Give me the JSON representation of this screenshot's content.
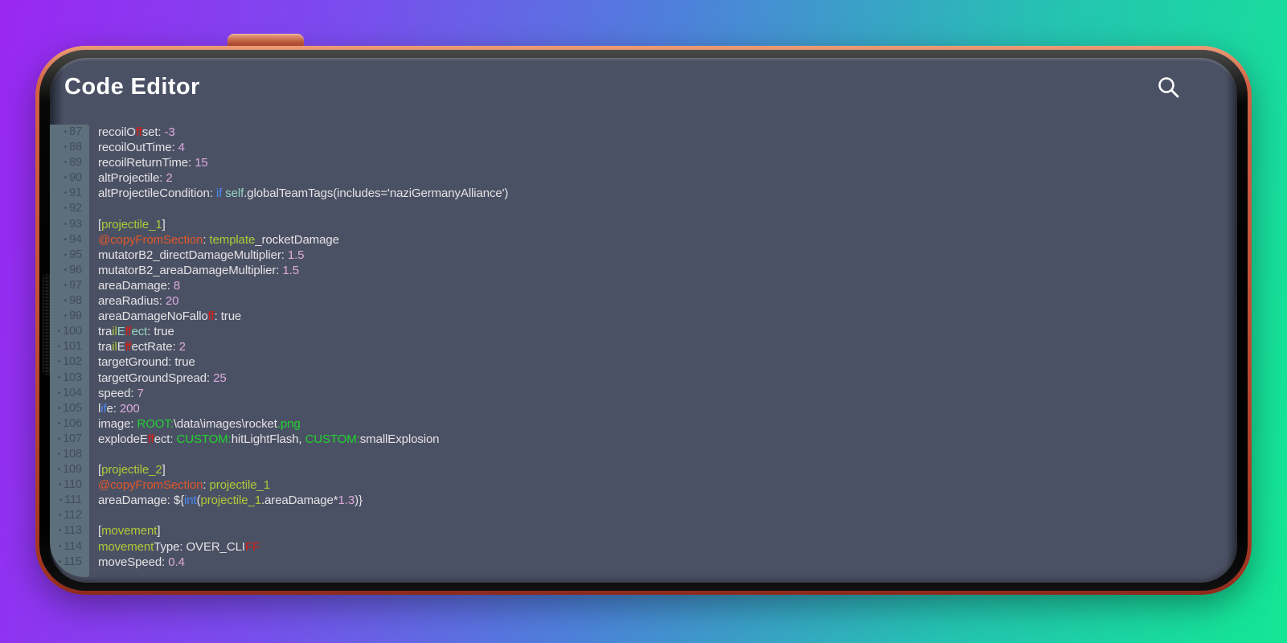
{
  "app": {
    "title": "Code Editor",
    "icons": {
      "search": "magnifying-glass"
    }
  },
  "colors": {
    "background_gradient": [
      "#9a27f2",
      "#13e794"
    ],
    "phone_rim": "#c14e36",
    "screen_bg": "#4b5164",
    "gutter_bg": "#5d6f7a",
    "line_number": "#434c60",
    "title_text": "#ffffff",
    "syntax": {
      "fg": "#e4e2e5",
      "num": "#dcaade",
      "kw": "#4a8bf5",
      "red": "#dd1d15",
      "sect": "#aeca38",
      "at": "#e2562a",
      "path": "#21d32f",
      "mint": "#98d6c2"
    }
  },
  "editor": {
    "bullet_char": "•",
    "first_line_number": 87,
    "last_line_number": 115,
    "lines": [
      {
        "n": 87,
        "segments": [
          {
            "t": "recoilO",
            "c": "fg"
          },
          {
            "t": "ff",
            "c": "red"
          },
          {
            "t": "set: ",
            "c": "fg"
          },
          {
            "t": "-3",
            "c": "num"
          }
        ]
      },
      {
        "n": 88,
        "segments": [
          {
            "t": "recoilOutTime: ",
            "c": "fg"
          },
          {
            "t": "4",
            "c": "num"
          }
        ]
      },
      {
        "n": 89,
        "segments": [
          {
            "t": "recoilReturnTime: ",
            "c": "fg"
          },
          {
            "t": "15",
            "c": "num"
          }
        ]
      },
      {
        "n": 90,
        "segments": [
          {
            "t": "altProjectile: ",
            "c": "fg"
          },
          {
            "t": "2",
            "c": "num"
          }
        ]
      },
      {
        "n": 91,
        "segments": [
          {
            "t": "altProjectileCondition: ",
            "c": "fg"
          },
          {
            "t": "if",
            "c": "kw"
          },
          {
            "t": " ",
            "c": "fg"
          },
          {
            "t": "self",
            "c": "mint"
          },
          {
            "t": ".globalTeamTags(includes='naziGermanyAlliance')",
            "c": "fg"
          }
        ]
      },
      {
        "n": 92,
        "segments": []
      },
      {
        "n": 93,
        "segments": [
          {
            "t": "[",
            "c": "fg"
          },
          {
            "t": "projectile_1",
            "c": "sect"
          },
          {
            "t": "]",
            "c": "fg"
          }
        ]
      },
      {
        "n": 94,
        "segments": [
          {
            "t": "@copyFromSection",
            "c": "at"
          },
          {
            "t": ": ",
            "c": "fg"
          },
          {
            "t": "template",
            "c": "sect"
          },
          {
            "t": "_rocketDamage",
            "c": "fg"
          }
        ]
      },
      {
        "n": 95,
        "segments": [
          {
            "t": "mutatorB2_directDamageMultiplier: ",
            "c": "fg"
          },
          {
            "t": "1.5",
            "c": "num"
          }
        ]
      },
      {
        "n": 96,
        "segments": [
          {
            "t": "mutatorB2_areaDamageMultiplier: ",
            "c": "fg"
          },
          {
            "t": "1.5",
            "c": "num"
          }
        ]
      },
      {
        "n": 97,
        "segments": [
          {
            "t": "areaDamage: ",
            "c": "fg"
          },
          {
            "t": "8",
            "c": "num"
          }
        ]
      },
      {
        "n": 98,
        "segments": [
          {
            "t": "areaRadius: ",
            "c": "fg"
          },
          {
            "t": "20",
            "c": "num"
          }
        ]
      },
      {
        "n": 99,
        "segments": [
          {
            "t": "areaDamageNoFallo",
            "c": "fg"
          },
          {
            "t": "ff",
            "c": "red"
          },
          {
            "t": ": true",
            "c": "fg"
          }
        ]
      },
      {
        "n": 100,
        "segments": [
          {
            "t": "tra",
            "c": "fg"
          },
          {
            "t": "il",
            "c": "sect"
          },
          {
            "t": "E",
            "c": "mint"
          },
          {
            "t": "ff",
            "c": "red"
          },
          {
            "t": "ect",
            "c": "mint"
          },
          {
            "t": ": true",
            "c": "fg"
          }
        ]
      },
      {
        "n": 101,
        "segments": [
          {
            "t": "tra",
            "c": "fg"
          },
          {
            "t": "il",
            "c": "sect"
          },
          {
            "t": "E",
            "c": "fg"
          },
          {
            "t": "ff",
            "c": "red"
          },
          {
            "t": "ectRate: ",
            "c": "fg"
          },
          {
            "t": "2",
            "c": "num"
          }
        ]
      },
      {
        "n": 102,
        "segments": [
          {
            "t": "targetGround: true",
            "c": "fg"
          }
        ]
      },
      {
        "n": 103,
        "segments": [
          {
            "t": "targetGroundSpread: ",
            "c": "fg"
          },
          {
            "t": "25",
            "c": "num"
          }
        ]
      },
      {
        "n": 104,
        "segments": [
          {
            "t": "speed: ",
            "c": "fg"
          },
          {
            "t": "7",
            "c": "num"
          }
        ]
      },
      {
        "n": 105,
        "segments": [
          {
            "t": "l",
            "c": "fg"
          },
          {
            "t": "if",
            "c": "kw"
          },
          {
            "t": "e: ",
            "c": "fg"
          },
          {
            "t": "200",
            "c": "num"
          }
        ]
      },
      {
        "n": 106,
        "segments": [
          {
            "t": "image: ",
            "c": "fg"
          },
          {
            "t": "ROOT:",
            "c": "path"
          },
          {
            "t": "\\data\\images\\rocket",
            "c": "fg"
          },
          {
            "t": ".png",
            "c": "path"
          }
        ]
      },
      {
        "n": 107,
        "segments": [
          {
            "t": "explodeE",
            "c": "fg"
          },
          {
            "t": "ff",
            "c": "red"
          },
          {
            "t": "ect: ",
            "c": "fg"
          },
          {
            "t": "CUSTOM:",
            "c": "path"
          },
          {
            "t": "hitLightFlash, ",
            "c": "fg"
          },
          {
            "t": "CUSTOM:",
            "c": "path"
          },
          {
            "t": "smallExplosion",
            "c": "fg"
          }
        ]
      },
      {
        "n": 108,
        "segments": []
      },
      {
        "n": 109,
        "segments": [
          {
            "t": "[",
            "c": "fg"
          },
          {
            "t": "projectile_2",
            "c": "sect"
          },
          {
            "t": "]",
            "c": "fg"
          }
        ]
      },
      {
        "n": 110,
        "segments": [
          {
            "t": "@copyFromSection",
            "c": "at"
          },
          {
            "t": ": ",
            "c": "fg"
          },
          {
            "t": "projectile_1",
            "c": "sect"
          }
        ]
      },
      {
        "n": 111,
        "segments": [
          {
            "t": "areaDamage: ${",
            "c": "fg"
          },
          {
            "t": "int",
            "c": "kw"
          },
          {
            "t": "(",
            "c": "fg"
          },
          {
            "t": "projectile_1",
            "c": "sect"
          },
          {
            "t": ".areaDamage*",
            "c": "fg"
          },
          {
            "t": "1.3",
            "c": "num"
          },
          {
            "t": ")}",
            "c": "fg"
          }
        ]
      },
      {
        "n": 112,
        "segments": []
      },
      {
        "n": 113,
        "segments": [
          {
            "t": "[",
            "c": "fg"
          },
          {
            "t": "movement",
            "c": "sect"
          },
          {
            "t": "]",
            "c": "fg"
          }
        ]
      },
      {
        "n": 114,
        "segments": [
          {
            "t": "movement",
            "c": "sect"
          },
          {
            "t": "Type: OVER_CLI",
            "c": "fg"
          },
          {
            "t": "FF",
            "c": "red"
          }
        ]
      },
      {
        "n": 115,
        "segments": [
          {
            "t": "moveSpeed: ",
            "c": "fg"
          },
          {
            "t": "0.4",
            "c": "num"
          }
        ]
      }
    ]
  }
}
